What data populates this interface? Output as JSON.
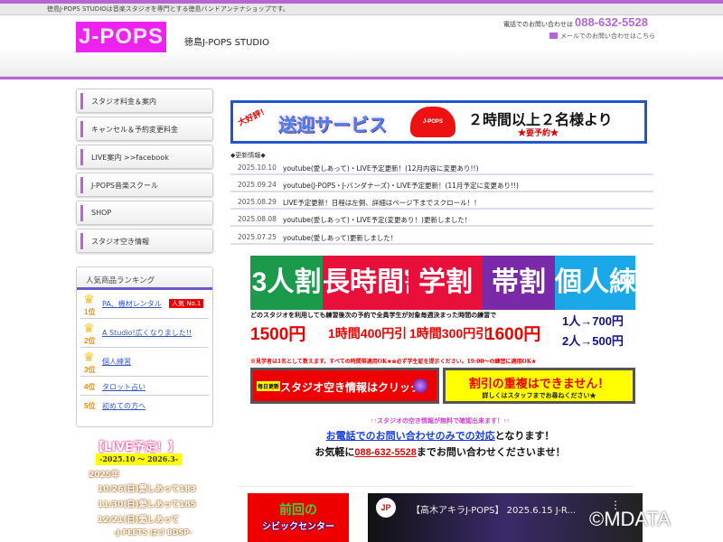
{
  "top_bar": {
    "text": "徳島J-POPS STUDIOは音楽スタジオを専門とする徳島バンドアンテナショップです。"
  },
  "header": {
    "logo": "J-POPS",
    "site_name": "徳島J-POPS STUDIO",
    "tel_label": "電話でのお問い合わせは",
    "tel": "088-632-5528",
    "mail_link": "メールでのお問い合わせはこちら"
  },
  "sidebar": {
    "nav": [
      {
        "label": "スタジオ料金＆案内"
      },
      {
        "label": "キャンセル＆予約変更料金"
      },
      {
        "label": "LIVE案内 >>facebook"
      },
      {
        "label": "J-POPS音楽スクール"
      },
      {
        "label": "SHOP"
      },
      {
        "label": "スタジオ空き情報"
      }
    ],
    "ranking": {
      "title": "人気商品ランキング",
      "items": [
        {
          "rank": "1位",
          "label": "PA、機材レンタル",
          "badge": "人気 No.1"
        },
        {
          "rank": "2位",
          "label": "A Studio!広くなりました!!"
        },
        {
          "rank": "3位",
          "label": "個人練習"
        },
        {
          "rank": "4位",
          "label": "タロット占い"
        },
        {
          "rank": "5位",
          "label": "初めての方へ"
        }
      ]
    },
    "live": {
      "title": "【LIVE予定！】",
      "period": "-2025.10 〜 2026.3-",
      "year": "2025年",
      "lines": [
        "10/26(日)愛しあって183",
        "11/30(日)愛しあって185",
        "12/21(日)愛しあって",
        "-J-FEETS はづ BDSP-"
      ]
    }
  },
  "banner": {
    "tag": "大好評！",
    "title": "送迎サービス",
    "car": "J-POPS",
    "cond": "２時間以上２名様より",
    "note": "★要予約★"
  },
  "news": {
    "heading": "◆更新情報◆",
    "items": [
      {
        "date": "2025.10.10",
        "text": "youtube(愛しあって)・LIVE予定更新！(12月内容に変更あり!!)"
      },
      {
        "date": "2025.09.24",
        "text": "youtube(J-POPS・J-バンダナーズ)・LIVE予定更新！(11月予定に変更あり!!)"
      },
      {
        "date": "2025.08.29",
        "text": "LIVE予定更新！日程は左側、詳細はページ下までスクロール！！"
      },
      {
        "date": "2025.08.08",
        "text": "youtube(愛しあって)・LIVE予定(変更あり！)更新しました！"
      },
      {
        "date": "2025.07.25",
        "text": "youtube(愛しあって)更新しました！"
      }
    ]
  },
  "promo": {
    "titles": [
      "3人割",
      "長時間割",
      "学割",
      "帯割",
      "個人練習"
    ],
    "colors": [
      "#1a9a4a",
      "#e8103a",
      "#e8103a",
      "#7a2aa8",
      "#1aa8e8"
    ],
    "sub": "どのスタジオを利用しても練習後次の予約で全員学生が対象毎週決まった時間の練習で",
    "prices": [
      "1500円",
      "1時間400円引",
      "1時間300円引",
      "1600円"
    ],
    "solo": [
      "1人→700円",
      "2人→500円"
    ],
    "note": "※見学者は1名として数えます。すべての時間帯適用OK★※必ず学生証を提示ください。19:00〜の練習に適用OK★",
    "btn_avail": "スタジオ空き情報はクリック",
    "btn_avail_tag": "毎日更新",
    "no_combine": "割引の重複はできません！",
    "no_combine_sub": "詳しくはスタッフまでお尋ねください★"
  },
  "info": {
    "free": "↑↑スタジオの空き情報が無料で確認出来ます！↑↑",
    "phone_only_link": "お電話でのお問い合わせのみでの対応",
    "phone_only_rest": "となります！",
    "call_pre": "お気軽に",
    "call_tel": "088-632-5528",
    "call_post": "までお問い合わせくださいませ！"
  },
  "bottom": {
    "prev_a": "前回の",
    "prev_b": "シビックセンター",
    "video_channel": "JP",
    "video_title": "【高木アキラJ-POPS】 2025.6.15 J-R..."
  },
  "watermark": "©MDATA"
}
